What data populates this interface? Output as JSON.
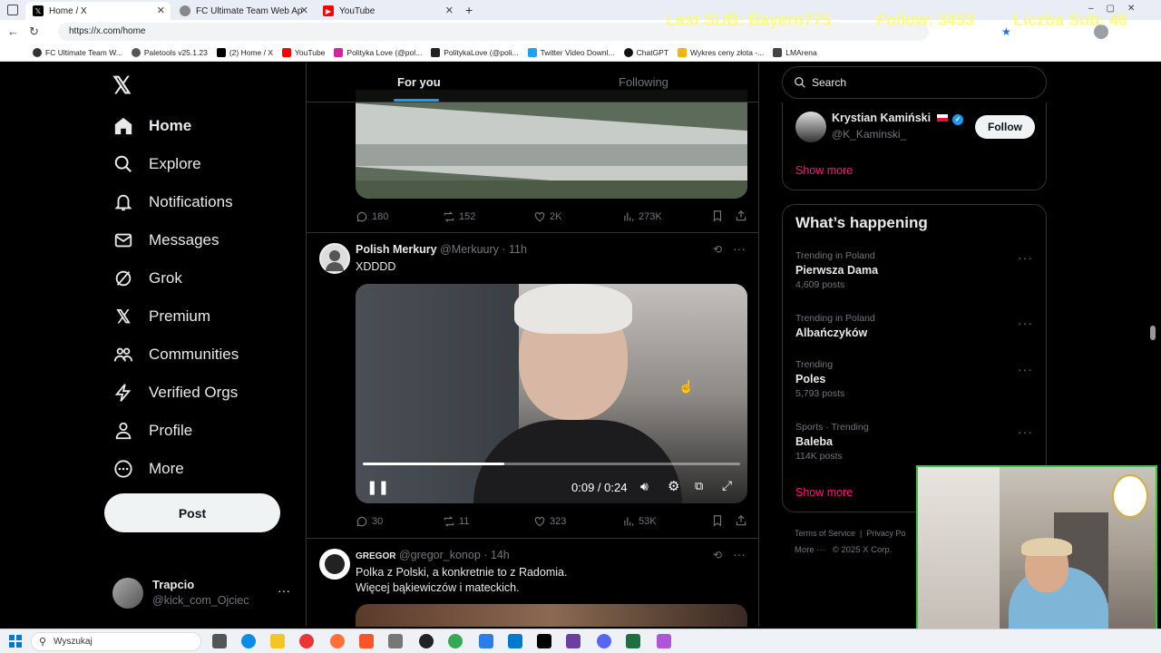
{
  "browser": {
    "tabs": [
      {
        "label": "Home / X",
        "active": true
      },
      {
        "label": "FC Ultimate Team Web App - EA S",
        "active": false
      },
      {
        "label": "YouTube",
        "active": false
      }
    ],
    "new_tab": "+",
    "url": "https://x.com/home",
    "bookmarks": [
      "FC Ultimate Team W...",
      "Paletools v25.1.23",
      "(2) Home / X",
      "YouTube",
      "Polityka Love (@pol...",
      "PolitykaLove (@poli...",
      "Twitter Video Downl...",
      "ChatGPT",
      "Wykres ceny złota -...",
      "LMArena"
    ]
  },
  "stream_overlay": {
    "last_sub": "Last SUB: Bayern775",
    "follow": "Follow: 3453",
    "subs": "Liczba Sub: 46"
  },
  "nav": {
    "items": [
      {
        "label": "Home",
        "icon": "home-icon"
      },
      {
        "label": "Explore",
        "icon": "search-icon"
      },
      {
        "label": "Notifications",
        "icon": "bell-icon"
      },
      {
        "label": "Messages",
        "icon": "mail-icon"
      },
      {
        "label": "Grok",
        "icon": "grok-icon"
      },
      {
        "label": "Premium",
        "icon": "x-logo-icon"
      },
      {
        "label": "Communities",
        "icon": "people-icon"
      },
      {
        "label": "Verified Orgs",
        "icon": "lightning-icon"
      },
      {
        "label": "Profile",
        "icon": "user-icon"
      },
      {
        "label": "More",
        "icon": "more-circle-icon"
      }
    ],
    "post_label": "Post",
    "account": {
      "name": "Trapcio",
      "handle": "@kick_com_Ojciec"
    }
  },
  "timeline": {
    "tabs": [
      "For you",
      "Following"
    ],
    "prev_post_actions": {
      "replies": "180",
      "reposts": "152",
      "likes": "2K",
      "views": "273K"
    },
    "post1": {
      "name": "Polish Merkury",
      "handle": "@Merkuury",
      "time": "· 11h",
      "text": "XDDDD",
      "video_time": "0:09 / 0:24",
      "video_progress": 0.375,
      "actions": {
        "replies": "30",
        "reposts": "11",
        "likes": "323",
        "views": "53K"
      }
    },
    "post2": {
      "name": "GREGOR",
      "handle": "@gregor_konop",
      "time": "· 14h",
      "text_line1": "Polka z Polski, a konkretnie to z Radomia.",
      "text_line2": "Więcej bąkiewiczów i mateckich."
    }
  },
  "right": {
    "search_placeholder": "Search",
    "follow_suggestion": {
      "name": "Krystian Kamiński",
      "handle": "@K_Kaminski_",
      "button": "Follow"
    },
    "show_more": "Show more",
    "happening_title": "What’s happening",
    "trends": [
      {
        "context": "Trending in Poland",
        "name": "Pierwsza Dama",
        "count": "4,609 posts"
      },
      {
        "context": "Trending in Poland",
        "name": "Albańczyków",
        "count": ""
      },
      {
        "context": "Trending",
        "name": "Poles",
        "count": "5,793 posts"
      },
      {
        "context": "Sports · Trending",
        "name": "Baleba",
        "count": "114K posts"
      }
    ],
    "show_more_2": "Show more",
    "footer_line1": "Terms of Service  |  Privacy Po",
    "footer_line2": "More ···   © 2025 X Corp."
  },
  "taskbar": {
    "search_label": "Wyszukaj"
  },
  "colors": {
    "accent_blue": "#1d9bf0",
    "pink": "#f91880",
    "overlay_yellow": "#ffff55"
  }
}
